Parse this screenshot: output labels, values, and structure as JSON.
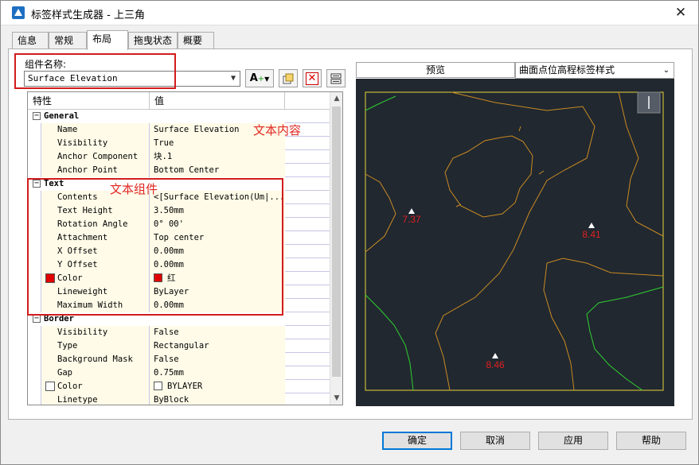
{
  "window": {
    "title": "标签样式生成器 - 上三角"
  },
  "tabs": [
    {
      "label": "信息"
    },
    {
      "label": "常规"
    },
    {
      "label": "布局"
    },
    {
      "label": "拖曳状态"
    },
    {
      "label": "概要"
    }
  ],
  "component": {
    "label": "组件名称:",
    "selected": "Surface Elevation"
  },
  "toolbar": {
    "add_text": "A",
    "add_plus": "+"
  },
  "grid": {
    "col_property": "特性",
    "col_value": "值",
    "groups": [
      {
        "title": "General",
        "rows": [
          {
            "name": "Name",
            "value": "Surface Elevation"
          },
          {
            "name": "Visibility",
            "value": "True"
          },
          {
            "name": "Anchor Component",
            "value": "块.1"
          },
          {
            "name": "Anchor Point",
            "value": "Bottom Center"
          }
        ]
      },
      {
        "title": "Text",
        "rows": [
          {
            "name": "Contents",
            "value": "<[Surface Elevation(Um|..."
          },
          {
            "name": "Text Height",
            "value": "3.50mm"
          },
          {
            "name": "Rotation Angle",
            "value": "0° 00'"
          },
          {
            "name": "Attachment",
            "value": "Top center"
          },
          {
            "name": "X Offset",
            "value": "0.00mm"
          },
          {
            "name": "Y Offset",
            "value": "0.00mm"
          },
          {
            "name": "Color",
            "value": "红",
            "swatch": "#e00000"
          },
          {
            "name": "Lineweight",
            "value": "ByLayer"
          },
          {
            "name": "Maximum Width",
            "value": "0.00mm"
          }
        ]
      },
      {
        "title": "Border",
        "rows": [
          {
            "name": "Visibility",
            "value": "False"
          },
          {
            "name": "Type",
            "value": "Rectangular"
          },
          {
            "name": "Background Mask",
            "value": "False"
          },
          {
            "name": "Gap",
            "value": "0.75mm"
          },
          {
            "name": "Color",
            "value": "BYLAYER",
            "swatch": "#ffffff"
          },
          {
            "name": "Linetype",
            "value": "ByBlock"
          }
        ]
      }
    ]
  },
  "annotations": {
    "text_content": "文本内容",
    "text_component": "文本组件"
  },
  "preview": {
    "tab_label": "预览",
    "style_selected": "曲面点位高程标签样式",
    "points": [
      {
        "label": "7.37"
      },
      {
        "label": "8.41"
      },
      {
        "label": "8.46"
      }
    ]
  },
  "buttons": {
    "ok": "确定",
    "cancel": "取消",
    "apply": "应用",
    "help": "帮助"
  }
}
